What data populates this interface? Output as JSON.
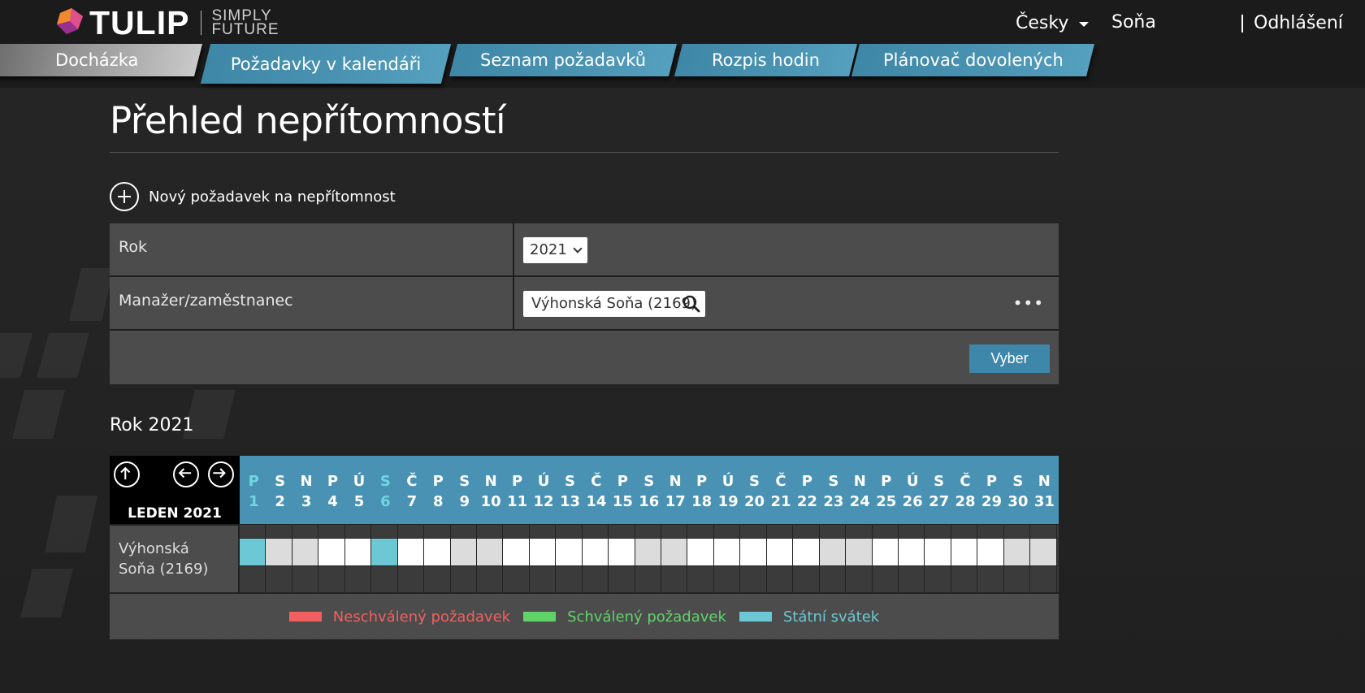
{
  "header": {
    "logo_text": "TULIP",
    "logo_sub_1": "SIMPLY",
    "logo_sub_2": "FUTURE",
    "language": "Česky",
    "user": "Soňa",
    "logout": "Odhlášení"
  },
  "tabs": [
    {
      "label": "Docházka",
      "active": true
    },
    {
      "label": "Požadavky v kalendáři",
      "active": false
    },
    {
      "label": "Seznam požadavků",
      "active": false
    },
    {
      "label": "Rozpis hodin",
      "active": false
    },
    {
      "label": "Plánovač dovolených",
      "active": false
    }
  ],
  "page": {
    "title": "Přehled nepřítomností",
    "new_request": "Nový požadavek na nepřítomnost"
  },
  "form": {
    "year_label": "Rok",
    "year_value": "2021",
    "employee_label": "Manažer/zaměstnanec",
    "employee_value": "Výhonská Soňa (2169)",
    "more": "•••",
    "submit": "Vyber"
  },
  "calendar": {
    "year_heading": "Rok 2021",
    "month_label": "LEDEN 2021",
    "days": [
      {
        "d": "P",
        "n": "1",
        "status": "holiday"
      },
      {
        "d": "S",
        "n": "2",
        "status": "weekend"
      },
      {
        "d": "N",
        "n": "3",
        "status": "weekend"
      },
      {
        "d": "P",
        "n": "4",
        "status": "work"
      },
      {
        "d": "Ú",
        "n": "5",
        "status": "work"
      },
      {
        "d": "S",
        "n": "6",
        "status": "holiday"
      },
      {
        "d": "Č",
        "n": "7",
        "status": "work"
      },
      {
        "d": "P",
        "n": "8",
        "status": "work"
      },
      {
        "d": "S",
        "n": "9",
        "status": "weekend"
      },
      {
        "d": "N",
        "n": "10",
        "status": "weekend"
      },
      {
        "d": "P",
        "n": "11",
        "status": "work"
      },
      {
        "d": "Ú",
        "n": "12",
        "status": "work"
      },
      {
        "d": "S",
        "n": "13",
        "status": "work"
      },
      {
        "d": "Č",
        "n": "14",
        "status": "work"
      },
      {
        "d": "P",
        "n": "15",
        "status": "work"
      },
      {
        "d": "S",
        "n": "16",
        "status": "weekend"
      },
      {
        "d": "N",
        "n": "17",
        "status": "weekend"
      },
      {
        "d": "P",
        "n": "18",
        "status": "work"
      },
      {
        "d": "Ú",
        "n": "19",
        "status": "work"
      },
      {
        "d": "S",
        "n": "20",
        "status": "work"
      },
      {
        "d": "Č",
        "n": "21",
        "status": "work"
      },
      {
        "d": "P",
        "n": "22",
        "status": "work"
      },
      {
        "d": "S",
        "n": "23",
        "status": "weekend"
      },
      {
        "d": "N",
        "n": "24",
        "status": "weekend"
      },
      {
        "d": "P",
        "n": "25",
        "status": "work"
      },
      {
        "d": "Ú",
        "n": "26",
        "status": "work"
      },
      {
        "d": "S",
        "n": "27",
        "status": "work"
      },
      {
        "d": "Č",
        "n": "28",
        "status": "work"
      },
      {
        "d": "P",
        "n": "29",
        "status": "work"
      },
      {
        "d": "S",
        "n": "30",
        "status": "weekend"
      },
      {
        "d": "N",
        "n": "31",
        "status": "weekend"
      }
    ],
    "employees": [
      {
        "name": "Výhonská Soňa (2169)"
      }
    ]
  },
  "legend": [
    {
      "label": "Neschválený požadavek",
      "color": "#f06060"
    },
    {
      "label": "Schválený požadavek",
      "color": "#5fd36a"
    },
    {
      "label": "Státní svátek",
      "color": "#6cc8d4"
    }
  ],
  "colors": {
    "accent_blue": "#4a92b4",
    "button_blue": "#3e87ab",
    "panel": "#4c4c4c"
  }
}
